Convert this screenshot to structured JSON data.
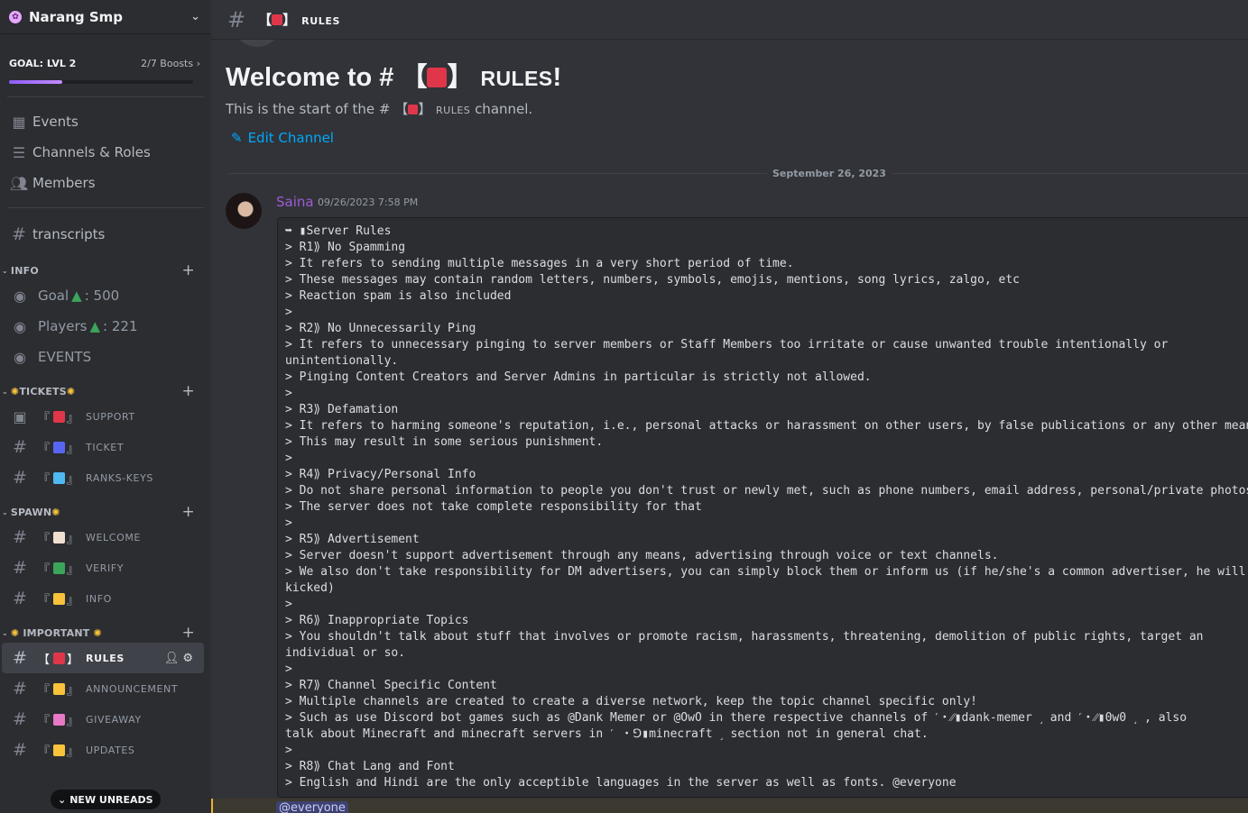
{
  "server": {
    "name": "Narang Smp",
    "goal_label": "GOAL: LVL 2",
    "boosts": "2/7 Boosts",
    "goal_progress": 0.29
  },
  "nav": [
    {
      "label": "Events",
      "icon": "calendar-icon"
    },
    {
      "label": "Channels & Roles",
      "icon": "channels-roles-icon"
    },
    {
      "label": "Members",
      "icon": "members-icon"
    }
  ],
  "transcripts": "transcripts",
  "categories": {
    "info": {
      "name": "INFO",
      "channels": [
        {
          "label": "Goal",
          "suffix": ": 500",
          "tree": "▲"
        },
        {
          "label": "Players",
          "suffix": ": 221",
          "tree": "▲"
        },
        {
          "label": "EVENTS"
        }
      ]
    },
    "tickets": {
      "name": "TICKETS",
      "channels": [
        {
          "label": "SUPPORT",
          "emoji_color": "#e0364a"
        },
        {
          "label": "TICKET",
          "emoji_color": "#5865f2"
        },
        {
          "label": "RANKS-KEYS",
          "emoji_color": "#4fb8f0"
        }
      ]
    },
    "spawn": {
      "name": "SPAWN",
      "channels": [
        {
          "label": "WELCOME",
          "emoji_color": "#f0e0d0"
        },
        {
          "label": "VERIFY",
          "emoji_color": "#3ba55c"
        },
        {
          "label": "INFO",
          "emoji_color": "#f8c33a"
        }
      ]
    },
    "important": {
      "name": "IMPORTANT",
      "channels": [
        {
          "label": "RULES",
          "emoji_color": "#e0364a"
        },
        {
          "label": "ANNOUNCEMENT",
          "emoji_color": "#f8c33a"
        },
        {
          "label": "GIVEAWAY",
          "emoji_color": "#e879c6"
        },
        {
          "label": "UPDATES",
          "emoji_color": "#f8c33a"
        }
      ]
    }
  },
  "new_unreads": "NEW UNREADS",
  "topbar": {
    "channel": "RULES"
  },
  "main": {
    "welcome_prefix": "Welcome to #",
    "welcome_suffix": "!",
    "start_prefix": "This is the start of the #",
    "start_suffix": "channel.",
    "edit_channel": "Edit Channel",
    "date_divider": "September 26, 2023",
    "mention": "@everyone"
  },
  "message": {
    "author": "Saina",
    "timestamp": "09/26/2023 7:58 PM",
    "lines": [
      "➥ ▮Server Rules",
      "> R1⟫ No Spamming",
      "> It refers to sending multiple messages in a very short period of time.",
      "> These messages may contain random letters, numbers, symbols, emojis, mentions, song lyrics, zalgo, etc",
      "> Reaction spam is also included",
      ">",
      "> R2⟫ No Unnecessarily Ping",
      "> It refers to unnecessary pinging to server members or Staff Members too irritate or cause unwanted trouble intentionally or",
      "unintentionally.",
      "> Pinging Content Creators and Server Admins in particular is strictly not allowed.",
      ">",
      "> R3⟫ Defamation",
      "> It refers to harming someone's reputation, i.e., personal attacks or harassment on other users, by false publications or any other mean",
      "> This may result in some serious punishment.",
      ">",
      "> R4⟫ Privacy/Personal Info",
      "> Do not share personal information to people you don't trust or newly met, such as phone numbers, email address, personal/private photos",
      "> The server does not take complete responsibility for that",
      ">",
      "> R5⟫ Advertisement",
      "> Server doesn't support advertisement through any means, advertising through voice or text channels.",
      "> We also don't take responsibility for DM advertisers, you can simply block them or inform us (if he/she's a common advertiser, he will",
      "kicked)",
      ">",
      "> R6⟫ Inappropriate Topics",
      "> You shouldn't talk about stuff that involves or promote racism, harassments, threatening, demolition of public rights, target an",
      "individual or so.",
      ">",
      "> R7⟫ Channel Specific Content",
      "> Multiple channels are created to create a diverse network, keep the topic channel specific only!",
      "> Such as use Discord bot games such as @Dank Memer or @OwO in there respective channels of ˹・⁄⁄▮dank-memer ˼ and ˹・⁄⁄▮0w0 ˼ , also",
      "talk about Minecraft and minecraft servers in ˹ ・⅁▮minecraft ˼ section not in general chat.",
      ">",
      "> R8⟫ Chat Lang and Font",
      "> English and Hindi are the only acceptible languages in the server as well as fonts. @everyone"
    ]
  }
}
